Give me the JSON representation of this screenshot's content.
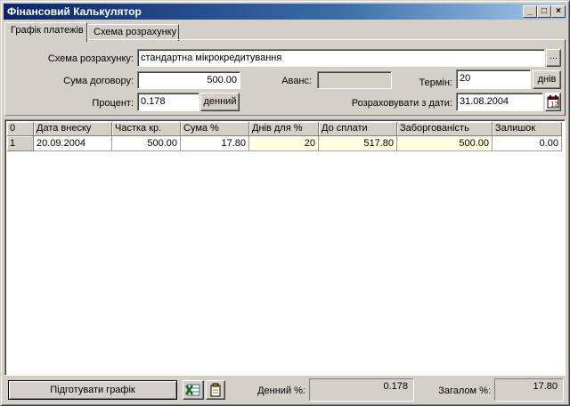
{
  "window": {
    "title": "Фінансовий Калькулятор"
  },
  "tabs": [
    {
      "label": "Графік платежів"
    },
    {
      "label": "Схема розрахунку"
    }
  ],
  "form": {
    "scheme_label": "Схема розрахунку:",
    "scheme_value": "стандартна мікрокредитування",
    "scheme_button": "...",
    "contract_sum_label": "Сума договору:",
    "contract_sum_value": "500.00",
    "advance_label": "Аванс:",
    "advance_value": "",
    "term_label": "Термін:",
    "term_value": "20",
    "term_unit_button": "днів",
    "percent_label": "Процент:",
    "percent_value": "0.178",
    "percent_unit_button": "денний",
    "calc_from_label": "Розраховувати з дати:",
    "calc_from_value": "31.08.2004"
  },
  "grid": {
    "columns": [
      "0",
      "Дата внеску",
      "Частка кр.",
      "Сума %",
      "Днів для %",
      "До сплати",
      "Заборгованість",
      "Залишок"
    ],
    "rows": [
      [
        "1",
        "20.09.2004",
        "500.00",
        "17.80",
        "20",
        "517.80",
        "500.00",
        "0.00"
      ]
    ]
  },
  "bottom": {
    "prepare_button": "Підготувати графік",
    "daily_label": "Денний %:",
    "daily_value": "0.178",
    "total_label": "Загалом %:",
    "total_value": "17.80"
  }
}
